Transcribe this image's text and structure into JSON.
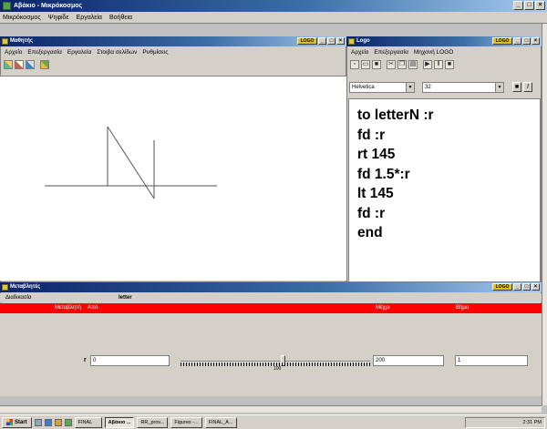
{
  "app": {
    "title": "Αβάκιο - Μικρόκοσμος"
  },
  "menu": [
    "Μικρόκοσμος",
    "Ψηφίδε",
    "Εργαλεία",
    "Βοήθεια"
  ],
  "graphics_window": {
    "title": "Μαθητής",
    "menu": [
      "Αρχείο",
      "Επεξεργασία",
      "Εργαλεία",
      "Στοιβα σελίδων",
      "Ρυθμίσεις"
    ],
    "toolbar_icons": [
      "grid-icon",
      "paint-icon",
      "picture-icon",
      "palette-icon"
    ]
  },
  "logo_window": {
    "title": "Logo",
    "menu": [
      "Αρχείο",
      "Επεξεργασία",
      "Μηχανή LOGO"
    ],
    "font_name": "Helvetica",
    "font_size": "32",
    "code_lines": [
      "to letterN :r",
      "fd :r",
      "rt 145",
      "fd 1.5*:r",
      "lt 145",
      "fd :r",
      "end"
    ]
  },
  "variables_window": {
    "title": "Μεταβλητές",
    "header_label": "Διαδικασία",
    "procedure_name": "letter",
    "columns": [
      "Μεταβλητή",
      "Από",
      "Μέχρι",
      "Βήμα"
    ],
    "variable_name": "r",
    "from_value": "0",
    "to_value": "200",
    "step_value": "1",
    "slider_value": "100"
  },
  "taskbar": {
    "start_label": "Start",
    "buttons": [
      "FINAL",
      "Αβάκιο ...",
      "RR_prov...",
      "Figures -...",
      "FINAL_A..."
    ],
    "clock": "2:31 PM"
  },
  "colors": {
    "accent_red": "#ff0000",
    "titlebar": "#0a246a"
  }
}
